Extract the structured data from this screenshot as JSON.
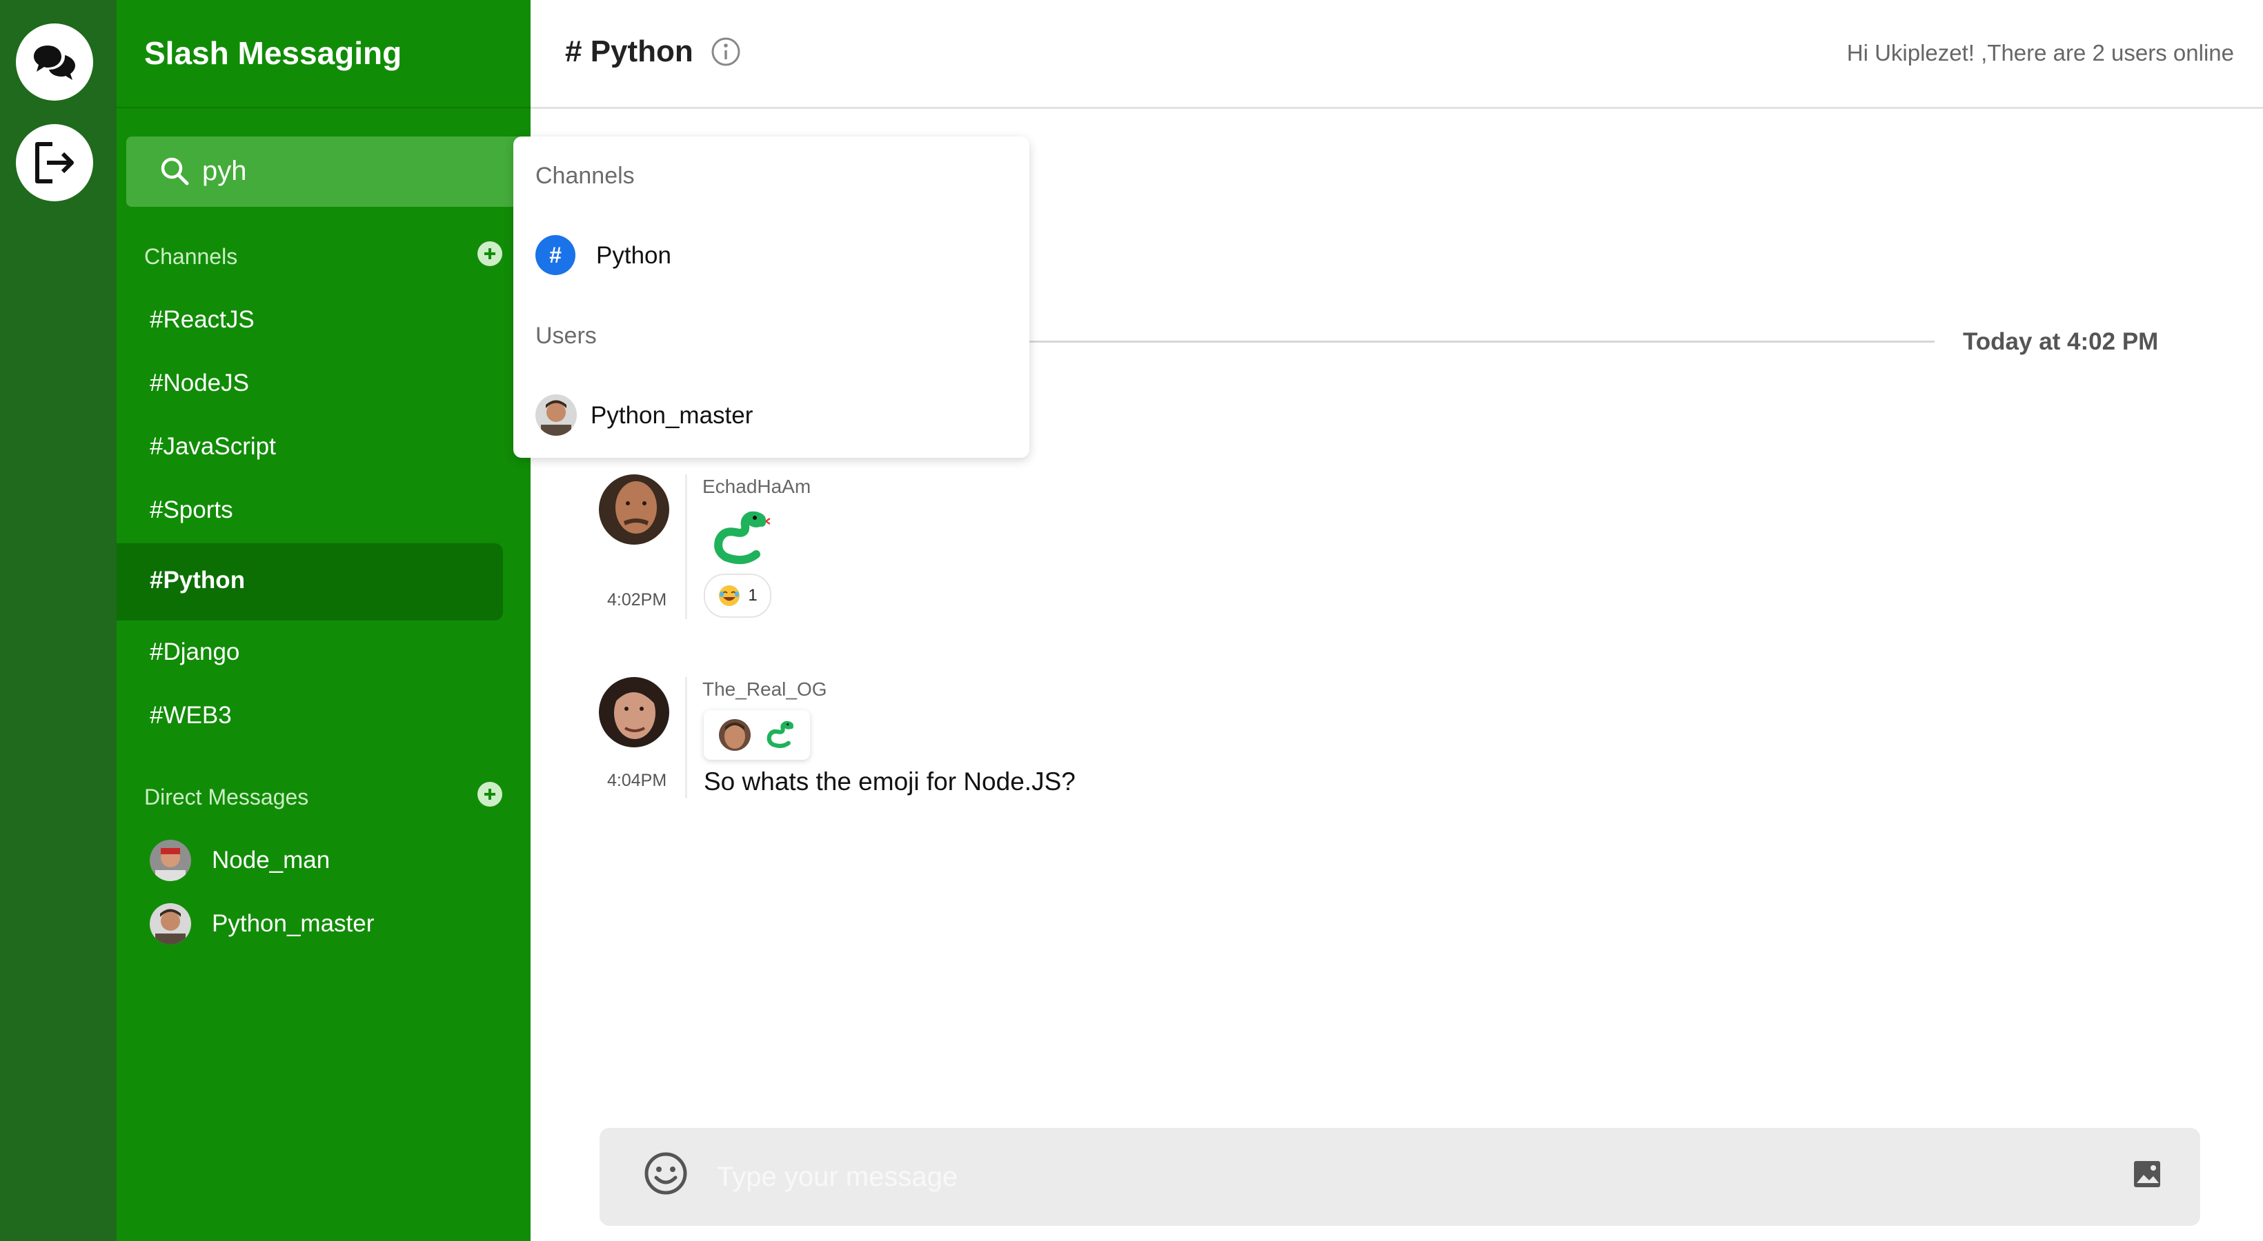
{
  "app": {
    "title": "Slash Messaging"
  },
  "rail": {
    "items": [
      "chat-bubbles-icon",
      "logout-icon"
    ]
  },
  "search": {
    "value": "pyh",
    "icon": "search-icon"
  },
  "sidebar": {
    "channels_label": "Channels",
    "channels": [
      "#ReactJS",
      "#NodeJS",
      "#JavaScript",
      "#Sports",
      "#Python",
      "#Django",
      "#WEB3"
    ],
    "active_channel": "#Python",
    "dm_label": "Direct Messages",
    "dms": [
      {
        "name": "Node_man"
      },
      {
        "name": "Python_master"
      }
    ]
  },
  "header": {
    "title": "# Python",
    "online_text": "Hi Ukiplezet! ,There are 2 users online"
  },
  "dropdown": {
    "channels_label": "Channels",
    "channel_hash": "#",
    "channel": "Python",
    "users_label": "Users",
    "user": "Python_master"
  },
  "timeline": {
    "date_label": "Today at 4:02 PM"
  },
  "messages": [
    {
      "user": "EchadHaAm",
      "time": "4:02PM",
      "content": "snake-emoji",
      "reaction_count": "1",
      "reaction_emoji": "laughing-emoji"
    },
    {
      "user": "The_Real_OG",
      "time": "4:04PM",
      "emojis": [
        "face-emoji",
        "snake-emoji"
      ],
      "text": "So whats the emoji for Node.JS?"
    }
  ],
  "composer": {
    "placeholder": "Type your message"
  },
  "colors": {
    "rail": "#1f6a1c",
    "sidebar": "#118c07",
    "search": "#44ac3a",
    "active_channel": "#0c6f04",
    "channel_hash_badge": "#1a73e8",
    "composer": "#ebebeb"
  }
}
